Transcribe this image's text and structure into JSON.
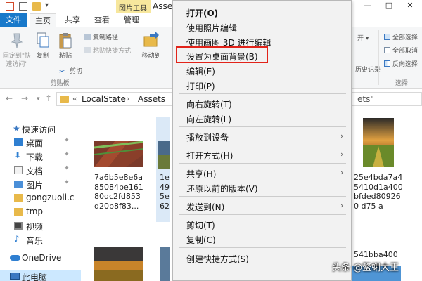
{
  "titlebar": {
    "context_tools": "图片工具",
    "title": "Assets",
    "controls": [
      "—",
      "□",
      "✕"
    ]
  },
  "ribbon_tabs": {
    "file": "文件",
    "home": "主页",
    "share": "共享",
    "view": "查看",
    "manage": "管理"
  },
  "ribbon": {
    "pin_quick_access": "固定到\"快\n速访问\"",
    "copy": "复制",
    "paste": "粘贴",
    "copy_path": "复制路径",
    "paste_shortcut": "粘贴快捷方式",
    "cut": "剪切",
    "clipboard_group": "剪贴板",
    "move_to": "移动到",
    "new_partial": "开 ▾",
    "history_partial": "历史记录",
    "select_all": "全部选择",
    "select_none": "全部取消",
    "invert_selection": "反向选择",
    "select_group": "选择"
  },
  "address": {
    "crumbs": [
      "LocalState",
      "Assets"
    ],
    "chevron": "«",
    "separator": "›",
    "search_partial": "ets\""
  },
  "nav": {
    "items": [
      {
        "label": "快速访问",
        "pinned": false
      },
      {
        "label": "桌面",
        "pinned": true
      },
      {
        "label": "下载",
        "pinned": true
      },
      {
        "label": "文档",
        "pinned": true
      },
      {
        "label": "图片",
        "pinned": true
      },
      {
        "label": "gongzuoli.c",
        "pinned": false
      },
      {
        "label": "tmp",
        "pinned": false
      },
      {
        "label": "视频",
        "pinned": false
      },
      {
        "label": "音乐",
        "pinned": false
      },
      {
        "label": "OneDrive",
        "pinned": false
      },
      {
        "label": "此电脑",
        "pinned": false
      }
    ],
    "pin_glyph": "📌"
  },
  "content": {
    "files": [
      {
        "name": "7a6b5e8e6a\n85084be161\n80dc2fd853\nd20b8f83..."
      },
      {
        "name": "1e\n49\n5e\n62"
      },
      {
        "name": "25e4bda7a4\n5410d1a400\nbfded80926\n0 d75 a"
      },
      {
        "name": "541bba400"
      }
    ]
  },
  "context_menu": {
    "items": [
      {
        "label": "打开(O)",
        "bold": true,
        "submenu": false
      },
      {
        "label": "使用照片编辑",
        "submenu": false
      },
      {
        "label": "使用画图 3D 进行编辑",
        "submenu": false
      },
      {
        "label": "设置为桌面背景(B)",
        "submenu": false,
        "highlighted": true
      },
      {
        "label": "编辑(E)",
        "submenu": false
      },
      {
        "label": "打印(P)",
        "submenu": false
      },
      {
        "label": "向右旋转(T)",
        "submenu": false
      },
      {
        "label": "向左旋转(L)",
        "submenu": false
      },
      {
        "label": "播放到设备",
        "submenu": true
      },
      {
        "label": "打开方式(H)",
        "submenu": true
      },
      {
        "label": "共享(H)",
        "submenu": true
      },
      {
        "label": "还原以前的版本(V)",
        "submenu": false
      },
      {
        "label": "发送到(N)",
        "submenu": true
      },
      {
        "label": "剪切(T)",
        "submenu": false
      },
      {
        "label": "复制(C)",
        "submenu": false
      },
      {
        "label": "创建快捷方式(S)",
        "submenu": false
      }
    ],
    "submenu_arrow": "›",
    "highlight_color": "#e2231a"
  },
  "watermark": "头条 @鳌蜊大王",
  "colors": {
    "file_tab": "#1979ca",
    "tools_tab": "#f7e79d",
    "selection": "#cce8ff"
  }
}
